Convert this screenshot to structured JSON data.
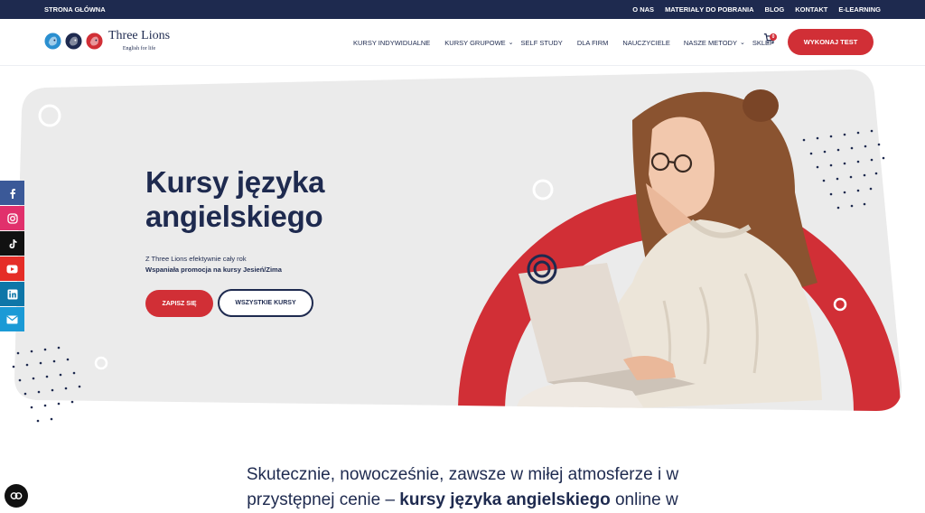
{
  "topbar": {
    "home": "STRONA GŁÓWNA",
    "links": [
      "O NAS",
      "MATERIAŁY DO POBRANIA",
      "BLOG",
      "KONTAKT",
      "E-LEARNING"
    ]
  },
  "brand": {
    "name": "Three Lions",
    "tagline": "English for life"
  },
  "nav": {
    "items": [
      "KURSY INDYWIDUALNE",
      "KURSY GRUPOWE",
      "SELF STUDY",
      "DLA FIRM",
      "NAUCZYCIELE",
      "NASZE METODY",
      "SKLEP"
    ],
    "cart_count": "0",
    "cta": "WYKONAJ TEST"
  },
  "hero": {
    "title": "Kursy języka angielskiego",
    "subtitle": "Z Three Lions efektywnie cały rok",
    "promo": "Wspaniała promocja na kursy Jesień/Zima",
    "btn_primary": "ZAPISZ SIĘ",
    "btn_secondary": "WSZYSTKIE KURSY"
  },
  "social": [
    "facebook-icon",
    "instagram-icon",
    "tiktok-icon",
    "youtube-icon",
    "linkedin-icon",
    "email-icon"
  ],
  "intro": {
    "line1": "Skutecznie, nowocześnie, zawsze w miłej atmosferze i w",
    "line2_pre": "przystępnej cenie – ",
    "line2_bold": "kursy języka angielskiego",
    "line2_post": " online w"
  },
  "colors": {
    "navy": "#1e2a4f",
    "red": "#d12f36",
    "hero_gray": "#ebebeb"
  }
}
